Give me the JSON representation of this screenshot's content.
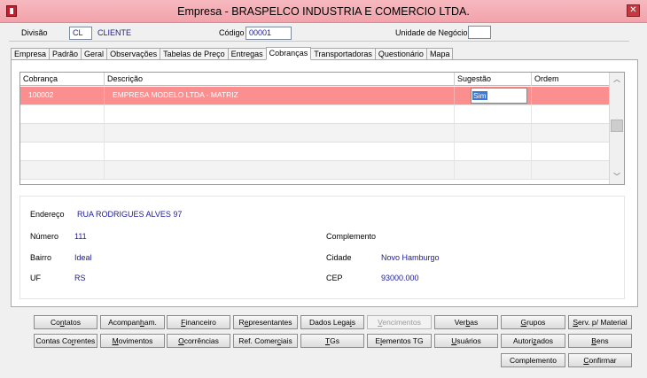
{
  "window": {
    "title": "Empresa - BRASPELCO INDUSTRIA E COMERCIO LTDA.",
    "close": "✕"
  },
  "header": {
    "divisao_label": "Divisão",
    "divisao_code": "CL",
    "divisao_name": "CLIENTE",
    "codigo_label": "Código",
    "codigo_value": "00001",
    "unidade_label": "Unidade de Negócio",
    "unidade_value": ""
  },
  "tabs": [
    "Empresa",
    "Padrão",
    "Geral",
    "Observações",
    "Tabelas de Preço",
    "Entregas",
    "Cobranças",
    "Transportadoras",
    "Questionário",
    "Mapa"
  ],
  "active_tab": "Cobranças",
  "grid": {
    "columns": [
      "Cobrança",
      "Descrição",
      "Sugestão",
      "Ordem"
    ],
    "rows": [
      {
        "cobranca": "100002",
        "descricao": "EMPRESA MODELO LTDA - MATRIZ",
        "sugestao": "Sim",
        "ordem": ""
      }
    ],
    "scroll_up": "︿",
    "scroll_down": "﹀"
  },
  "address": {
    "endereco_label": "Endereço",
    "endereco": "RUA RODRIGUES ALVES 97",
    "numero_label": "Número",
    "numero": "111",
    "complemento_label": "Complemento",
    "complemento": "",
    "bairro_label": "Bairro",
    "bairro": "Ideal",
    "cidade_label": "Cidade",
    "cidade": "Novo Hamburgo",
    "uf_label": "UF",
    "uf": "RS",
    "cep_label": "CEP",
    "cep": "93000.000"
  },
  "buttons": {
    "row1": [
      {
        "pre": "Co",
        "u": "n",
        "post": "tatos"
      },
      {
        "pre": "Acompan",
        "u": "h",
        "post": "am."
      },
      {
        "pre": "",
        "u": "F",
        "post": "inanceiro"
      },
      {
        "pre": "R",
        "u": "e",
        "post": "presentantes"
      },
      {
        "pre": "Dados Lega",
        "u": "i",
        "post": "s"
      },
      {
        "pre": "",
        "u": "V",
        "post": "encimentos"
      },
      {
        "pre": "Ver",
        "u": "b",
        "post": "as"
      },
      {
        "pre": "",
        "u": "G",
        "post": "rupos"
      },
      {
        "pre": "",
        "u": "S",
        "post": "erv. p/ Material"
      }
    ],
    "row2": [
      {
        "pre": "Contas Co",
        "u": "r",
        "post": "rentes"
      },
      {
        "pre": "",
        "u": "M",
        "post": "ovimentos"
      },
      {
        "pre": "",
        "u": "O",
        "post": "corrências"
      },
      {
        "pre": "Ref. Comer",
        "u": "c",
        "post": "iais"
      },
      {
        "pre": "",
        "u": "T",
        "post": "Gs"
      },
      {
        "pre": "E",
        "u": "l",
        "post": "ementos TG"
      },
      {
        "pre": "",
        "u": "U",
        "post": "suários"
      },
      {
        "pre": "Autori",
        "u": "z",
        "post": "ados"
      },
      {
        "pre": "",
        "u": "B",
        "post": "ens"
      }
    ],
    "row3": [
      {
        "pre": "Complemento",
        "u": "",
        "post": ""
      },
      {
        "pre": "",
        "u": "C",
        "post": "onfirmar"
      }
    ]
  }
}
